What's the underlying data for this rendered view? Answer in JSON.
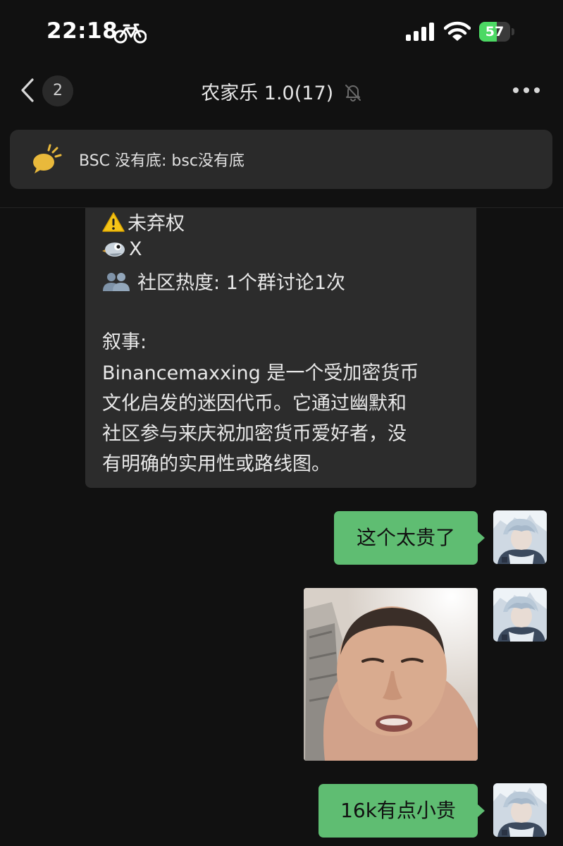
{
  "status_bar": {
    "time": "22:18",
    "battery_level": "57",
    "battery_fraction": 0.57,
    "icons": [
      "bicycle-icon",
      "cellular-signal-icon",
      "wifi-icon",
      "battery-charging-icon"
    ]
  },
  "nav": {
    "unread_count": "2",
    "title": "农家乐 1.0(17)",
    "icons": [
      "back-chevron-icon",
      "mute-bell-icon",
      "more-dots-icon"
    ]
  },
  "pinned": {
    "text": "BSC 没有底: bsc没有底",
    "icon": "announcement-speaker-icon"
  },
  "messages": {
    "received": {
      "line1": "未弃权",
      "line2": "X",
      "line3": "社区热度: 1个群讨论1次",
      "line4": "叙事:",
      "line5": "Binancemaxxing 是一个受加密货币",
      "line6": "文化启发的迷因代币。它通过幽默和",
      "line7": "社区参与来庆祝加密货币爱好者，没",
      "line8": "有明确的实用性或路线图。",
      "emojis": [
        "warning-emoji",
        "bird-emoji",
        "people-emoji"
      ]
    },
    "sent1": "这个太贵了",
    "sent2_image": "selfie-photo",
    "sent3": "16k有点小贵"
  },
  "colors": {
    "background": "#111111",
    "bubble_received": "#2c2c2c",
    "bubble_sent": "#5fbd72",
    "battery": "#4cd964"
  }
}
